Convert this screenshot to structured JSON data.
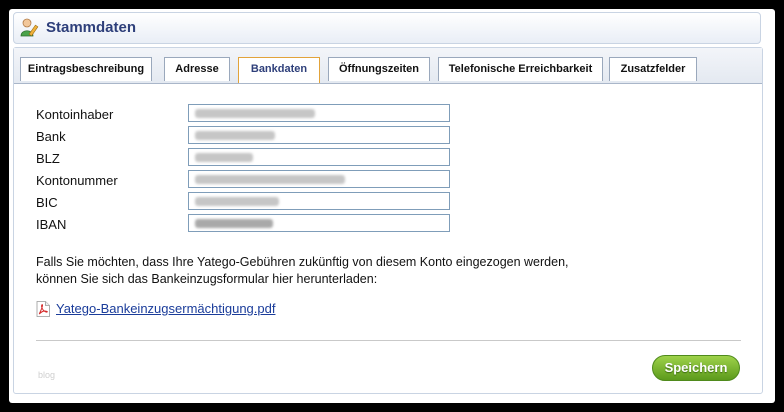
{
  "header": {
    "title": "Stammdaten",
    "icon": "user-edit-icon"
  },
  "tabs": [
    {
      "label": "Eintragsbeschreibung",
      "active": false
    },
    {
      "label": "Adresse",
      "active": false
    },
    {
      "label": "Bankdaten",
      "active": true
    },
    {
      "label": "Öffnungszeiten",
      "active": false
    },
    {
      "label": "Telefonische Erreichbarkeit",
      "active": false
    },
    {
      "label": "Zusatzfelder",
      "active": false
    }
  ],
  "form": {
    "fields": [
      {
        "label": "Kontoinhaber",
        "value_obscured": true
      },
      {
        "label": "Bank",
        "value_obscured": true
      },
      {
        "label": "BLZ",
        "value_obscured": true
      },
      {
        "label": "Kontonummer",
        "value_obscured": true
      },
      {
        "label": "BIC",
        "value_obscured": true
      },
      {
        "label": "IBAN",
        "value_obscured": true
      }
    ]
  },
  "note": {
    "line1": "Falls Sie möchten, dass Ihre Yatego-Gebühren zukünftig von diesem Konto eingezogen werden,",
    "line2": "können Sie sich das Bankeinzugsformular hier herunterladen:"
  },
  "download": {
    "label": "Yatego-Bankeinzugsermächtigung.pdf",
    "icon": "pdf-icon"
  },
  "watermark": "blog",
  "actions": {
    "save_label": "Speichern"
  },
  "colors": {
    "accent": "#2e3f7a",
    "active_tab_border": "#e2a33a",
    "save_button": "#6aa823",
    "link": "#1a3c9a"
  }
}
